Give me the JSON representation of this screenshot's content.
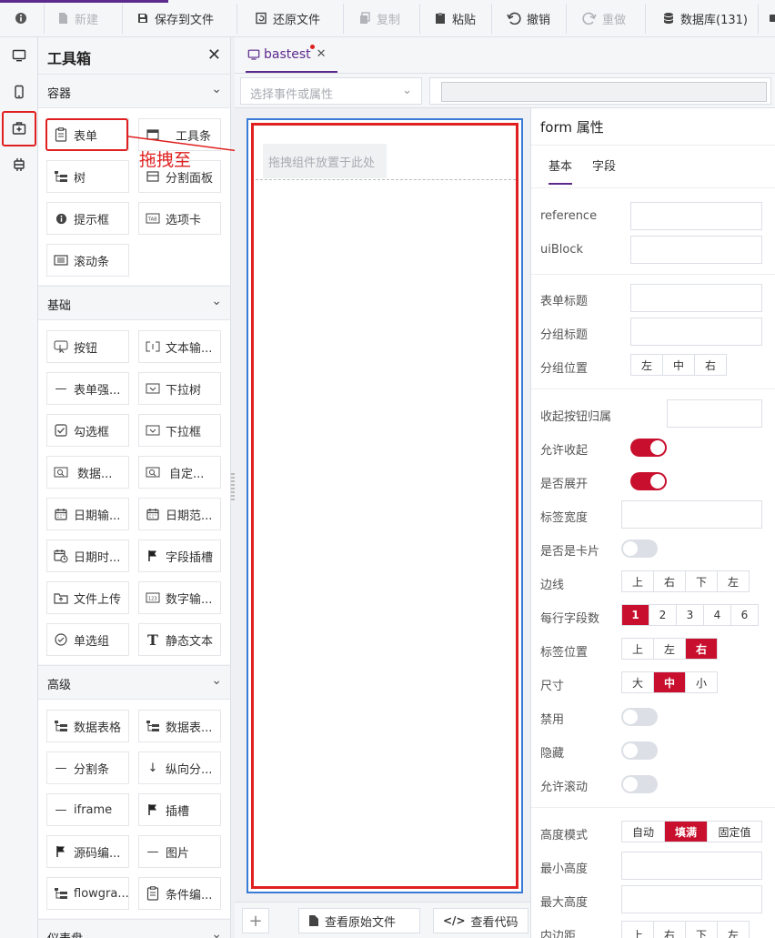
{
  "toolbar": {
    "items": [
      {
        "label": "新建",
        "icon": "file-new-icon",
        "disabled": true
      },
      {
        "label": "保存到文件",
        "icon": "save-icon",
        "disabled": false
      },
      {
        "label": "还原文件",
        "icon": "restore-file-icon",
        "disabled": false
      },
      {
        "label": "复制",
        "icon": "copy-icon",
        "disabled": true
      },
      {
        "label": "粘贴",
        "icon": "paste-icon",
        "disabled": false
      },
      {
        "label": "撤销",
        "icon": "undo-icon",
        "disabled": false
      },
      {
        "label": "重做",
        "icon": "redo-icon",
        "disabled": true
      },
      {
        "label": "数据库(131)",
        "icon": "database-icon",
        "disabled": false
      }
    ]
  },
  "rail": [
    "desktop-icon",
    "mobile-icon",
    "toolbox-icon",
    "plugin-icon"
  ],
  "toolbox": {
    "title": "工具箱",
    "sections": [
      {
        "title": "容器",
        "items": [
          "表单",
          "工具条",
          "树",
          "分割面板",
          "提示框",
          "选项卡",
          "滚动条"
        ]
      },
      {
        "title": "基础",
        "items": [
          "按钮",
          "文本输...",
          "表单强...",
          "下拉树",
          "勾选框",
          "下拉框",
          "数据...",
          "自定...",
          "日期输...",
          "日期范...",
          "日期时...",
          "字段插槽",
          "文件上传",
          "数字输...",
          "单选组",
          "静态文本"
        ]
      },
      {
        "title": "高级",
        "items": [
          "数据表格",
          "数据表...",
          "分割条",
          "纵向分...",
          "iframe",
          "插槽",
          "源码编...",
          "图片",
          "flowgra...",
          "条件编..."
        ]
      },
      {
        "title": "仪表盘",
        "items": []
      }
    ]
  },
  "annotation": "拖拽至",
  "tab": {
    "label": "bastest"
  },
  "event_select": {
    "placeholder": "选择事件或属性"
  },
  "canvas": {
    "drop_hint": "拖拽组件放置于此处"
  },
  "bottom": {
    "view_source": "查看原始文件",
    "view_code": "查看代码"
  },
  "props": {
    "title": "form 属性",
    "tabs": [
      "基本",
      "字段"
    ],
    "labels": {
      "reference": "reference",
      "uiblock": "uiBlock",
      "form_title": "表单标题",
      "group_title": "分组标题",
      "group_pos": "分组位置",
      "collapse_owner": "收起按钮归属",
      "allow_collapse": "允许收起",
      "expanded": "是否展开",
      "label_width": "标签宽度",
      "is_card": "是否是卡片",
      "border": "边线",
      "fields_per_row": "每行字段数",
      "label_pos": "标签位置",
      "size": "尺寸",
      "disabled": "禁用",
      "hidden": "隐藏",
      "allow_scroll": "允许滚动",
      "height_mode": "高度模式",
      "min_height": "最小高度",
      "max_height": "最大高度",
      "padding": "内边距"
    },
    "group_pos_opts": [
      "左",
      "中",
      "右"
    ],
    "border_opts": [
      "上",
      "右",
      "下",
      "左"
    ],
    "fields_opts": [
      "1",
      "2",
      "3",
      "4",
      "6"
    ],
    "fields_selected": "1",
    "label_pos_opts": [
      "上",
      "左",
      "右"
    ],
    "label_pos_selected": "右",
    "size_opts": [
      "大",
      "中",
      "小"
    ],
    "size_selected": "中",
    "height_opts": [
      "自动",
      "填满",
      "固定值"
    ],
    "height_selected": "填满",
    "padding_opts": [
      "上",
      "右",
      "下",
      "左"
    ],
    "allow_collapse": true,
    "expanded": true,
    "is_card": false,
    "disabled_on": false,
    "hidden_on": false,
    "allow_scroll": false
  },
  "colors": {
    "accent": "#5b2a8c",
    "primary": "#c8102e",
    "highlight": "#e02020",
    "canvas_border": "#3a7bd5"
  }
}
